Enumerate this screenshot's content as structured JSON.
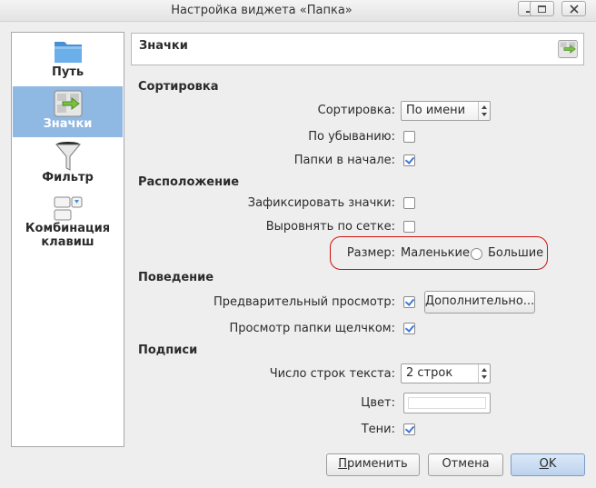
{
  "window": {
    "title": "Настройка виджета «Папка»"
  },
  "sidebar": {
    "items": [
      {
        "label": "Путь",
        "icon": "folder-icon"
      },
      {
        "label": "Значки",
        "icon": "icons-view-icon",
        "selected": true
      },
      {
        "label": "Фильтр",
        "icon": "funnel-icon"
      },
      {
        "label_line1": "Комбинация",
        "label_line2": "клавиш",
        "icon": "keyboard-shortcut-icon"
      }
    ]
  },
  "page": {
    "title": "Значки",
    "header_icon": "icons-view-icon"
  },
  "sorting": {
    "section": "Сортировка",
    "sort_label": "Сортировка:",
    "sort_value": "По имени",
    "descending_label": "По убыванию:",
    "descending_checked": false,
    "folders_first_label": "Папки в начале:",
    "folders_first_checked": true
  },
  "layout": {
    "section": "Расположение",
    "lock_label": "Зафиксировать значки:",
    "lock_checked": false,
    "align_label": "Выровнять по сетке:",
    "align_checked": false,
    "size_label": "Размер:",
    "size_small": "Маленькие",
    "size_large": "Большие"
  },
  "behavior": {
    "section": "Поведение",
    "preview_label": "Предварительный просмотр:",
    "preview_checked": true,
    "more_button": "Дополнительно...",
    "click_browse_label": "Просмотр папки щелчком:",
    "click_browse_checked": true
  },
  "captions": {
    "section": "Подписи",
    "lines_label": "Число строк текста:",
    "lines_value": "2 строк",
    "color_label": "Цвет:",
    "color_value": "#ffffff",
    "shadows_label": "Тени:",
    "shadows_checked": true
  },
  "buttons": {
    "apply": "Применить",
    "cancel": "Отмена",
    "ok": "OK"
  },
  "colors": {
    "selection": "#8fb8e2",
    "checkmark": "#3d7ad8",
    "highlight_outline": "#d01010"
  }
}
